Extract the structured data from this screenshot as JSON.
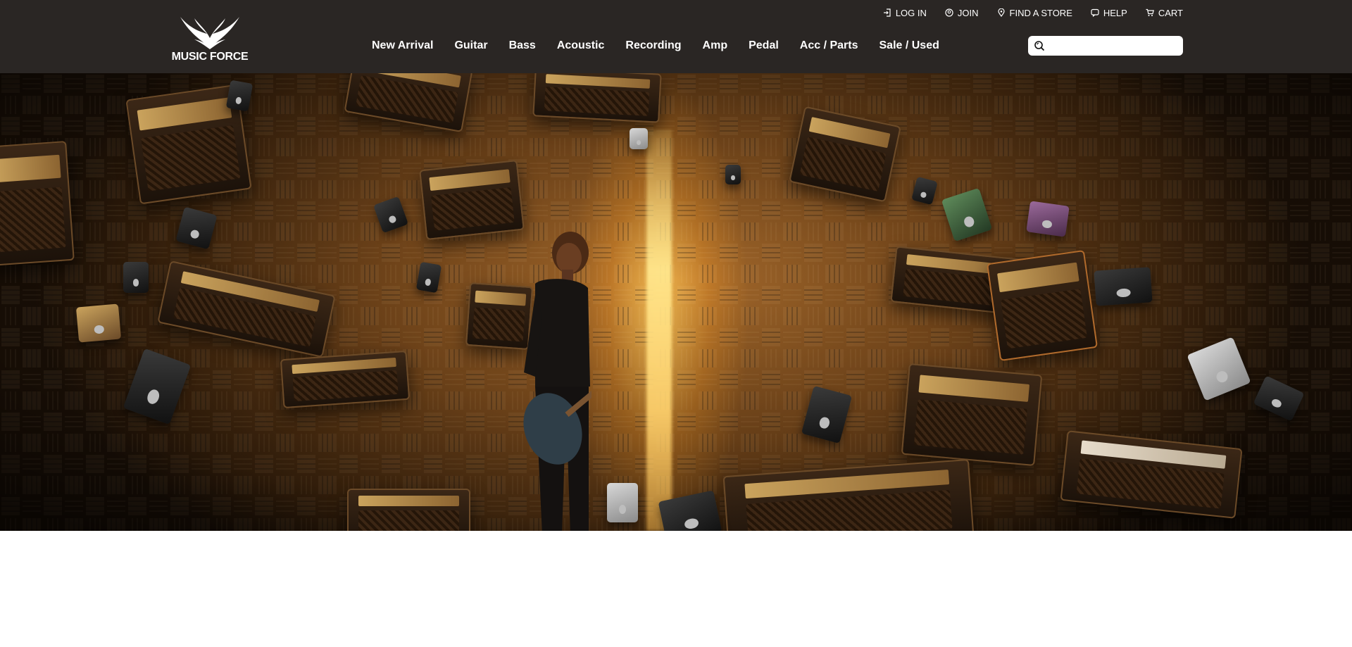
{
  "brand": {
    "name": "MUSIC FORCE",
    "logo_icon": "wings-logo"
  },
  "utility_nav": [
    {
      "label": "LOG IN",
      "icon": "login-icon"
    },
    {
      "label": "JOIN",
      "icon": "user-circle-icon"
    },
    {
      "label": "FIND A STORE",
      "icon": "location-pin-icon"
    },
    {
      "label": "HELP",
      "icon": "chat-bubble-icon"
    },
    {
      "label": "CART",
      "icon": "cart-icon"
    }
  ],
  "main_nav": [
    {
      "label": "New Arrival"
    },
    {
      "label": "Guitar"
    },
    {
      "label": "Bass"
    },
    {
      "label": "Acoustic"
    },
    {
      "label": "Recording"
    },
    {
      "label": "Amp"
    },
    {
      "label": "Pedal"
    },
    {
      "label": "Acc / Parts"
    },
    {
      "label": "Sale / Used"
    }
  ],
  "search": {
    "value": "",
    "placeholder": "",
    "icon": "search-icon"
  },
  "hero": {
    "description_icon": "hero-banner-image"
  },
  "colors": {
    "header_bg": "#2a2624",
    "header_text": "#ffffff",
    "hero_accent": "#f5a623"
  }
}
